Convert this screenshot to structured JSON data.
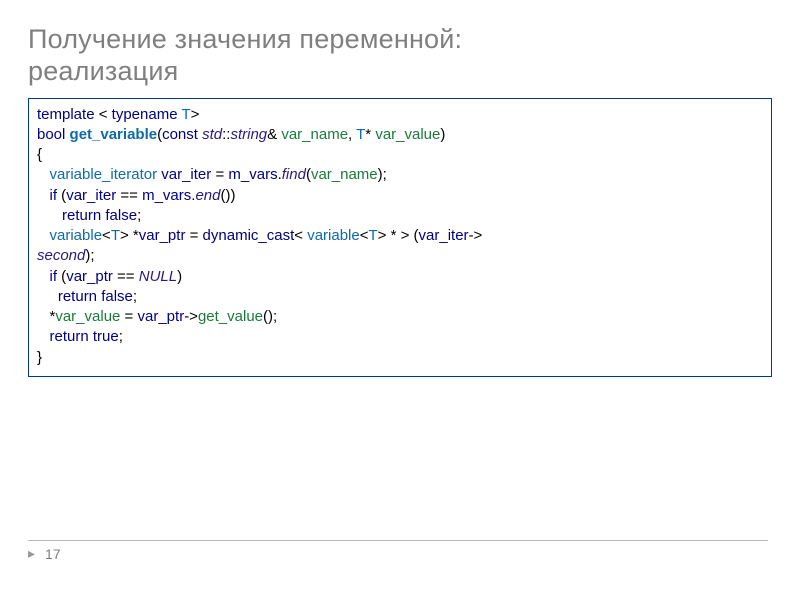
{
  "slide": {
    "title_line_1": "Получение значения переменной:",
    "title_line_2": "реализация",
    "page_number": "17"
  },
  "code": {
    "l1": {
      "tpl": "template",
      "ang1": " < ",
      "tn": "typename",
      "sp": " ",
      "T": "T",
      "ang2": ">"
    },
    "l2": {
      "bool": "bool",
      "sp1": " ",
      "fn": "get_variable",
      "po": "(",
      "const": "const",
      "sp2": " ",
      "std": "std",
      "cc": "::",
      "string": "string",
      "amp": "& ",
      "vn": "var_name",
      "cm": ", ",
      "T": "T",
      "star": "* ",
      "vv": "var_value",
      "pc": ")"
    },
    "l3": {
      "brace": "{"
    },
    "l4": {
      "ind": "   ",
      "vit": "variable_iterator",
      "sp1": " ",
      "vi": "var_iter",
      "eq": " = ",
      "mv": "m_vars",
      "dot": ".",
      "find": "find",
      "po": "(",
      "vn": "var_name",
      "pc": ");"
    },
    "l5": {
      "ind": "   ",
      "if": "if",
      "po": " (",
      "vi": "var_iter",
      "eq": " == ",
      "mv": "m_vars",
      "dot": ".",
      "end": "end",
      "pc": "())"
    },
    "l6": {
      "ind": "      ",
      "ret": "return",
      "sp": " ",
      "false": "false",
      "sc": ";"
    },
    "l7": {
      "ind": "   ",
      "vt": "variable",
      "ang1": "<",
      "T": "T",
      "ang2": "> *",
      "vp": "var_ptr",
      "eq": " = ",
      "dc": "dynamic_cast",
      "ang3": "< ",
      "vt2": "variable",
      "ang4": "<",
      "T2": "T",
      "ang5": "> * > (",
      "vi": "var_iter",
      "arr": "->"
    },
    "l7b": {
      "sec": "second",
      "pc": ");"
    },
    "l8": {
      "ind": "   ",
      "if": "if",
      "po": " (",
      "vp": "var_ptr",
      "eq": " == ",
      "null": "NULL",
      "pc": ")"
    },
    "l9": {
      "ind": "     ",
      "ret": "return",
      "sp": " ",
      "false": "false",
      "sc": ";"
    },
    "l10": {
      "ind": "   *",
      "vv": "var_value",
      "eq": " = ",
      "vp": "var_ptr",
      "arr": "->",
      "gv": "get_value",
      "pc": "();"
    },
    "l11": {
      "ind": "   ",
      "ret": "return",
      "sp": " ",
      "true": "true",
      "sc": ";"
    },
    "l12": {
      "brace": "}"
    }
  }
}
